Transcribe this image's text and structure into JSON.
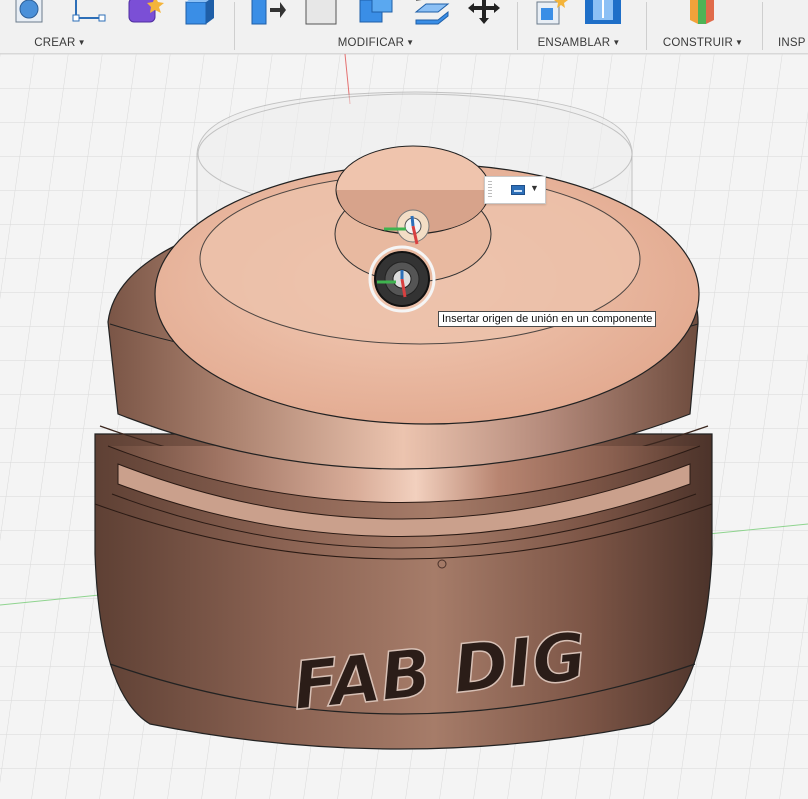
{
  "toolbar": {
    "groups": [
      {
        "label": "CREAR",
        "icons": [
          "sketch-circle-icon",
          "sketch-line-icon",
          "create-form-icon",
          "box-solid-icon"
        ]
      },
      {
        "label": "MODIFICAR",
        "icons": [
          "press-pull-icon",
          "fillet-icon",
          "combine-icon",
          "offset-face-icon",
          "move-icon"
        ]
      },
      {
        "label": "ENSAMBLAR",
        "icons": [
          "new-component-icon",
          "joint-icon"
        ]
      },
      {
        "label": "CONSTRUIR",
        "icons": [
          "construct-plane-icon"
        ]
      },
      {
        "label": "INSP"
      }
    ]
  },
  "model": {
    "embossed_text": "FAB DIG",
    "body_color": "#c8998a"
  },
  "tooltip": {
    "text": "Insertar origen de unión en un componente"
  },
  "colors": {
    "accent_blue": "#2d6fb8",
    "axis_red": "#d84040",
    "axis_green": "#3fb34f"
  }
}
